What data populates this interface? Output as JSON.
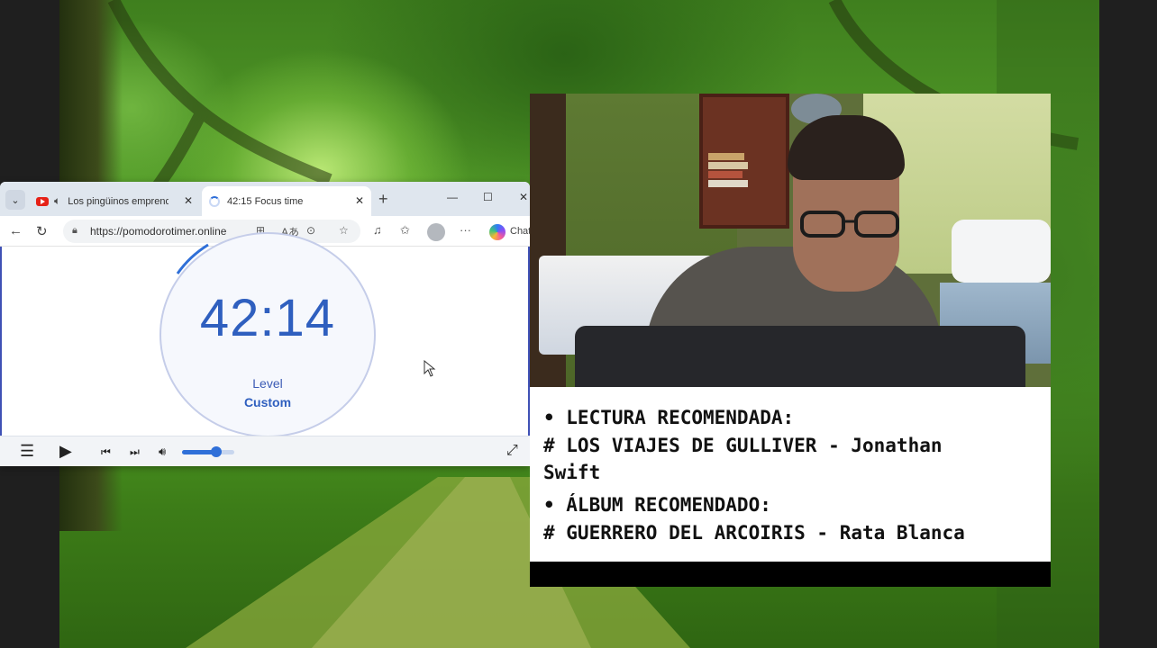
{
  "browser": {
    "tabs": [
      {
        "title": "Los pingüinos emprend",
        "icon": "youtube-icon",
        "audio": "speaker-icon"
      },
      {
        "title": "42:15 Focus time",
        "icon": "loading-spinner-icon"
      }
    ],
    "new_tab_symbol": "+",
    "window_controls": {
      "minimize": "—",
      "maximize": "☐",
      "close": "✕"
    },
    "address": {
      "url": "https://pomodorotimer.online"
    },
    "copilot_label": "Chat"
  },
  "timer": {
    "value": "42:14",
    "level_label": "Level",
    "level_value": "Custom"
  },
  "player": {
    "volume": 0.66
  },
  "recommendations": {
    "lines": [
      "• LECTURA RECOMENDADA:",
      "# LOS VIAJES DE GULLIVER - Jonathan",
      "Swift",
      "• ÁLBUM RECOMENDADO:",
      "# GUERRERO DEL ARCOIRIS - Rata Blanca"
    ]
  }
}
